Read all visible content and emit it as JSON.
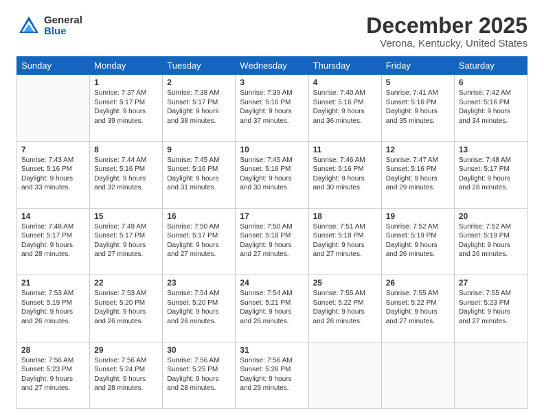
{
  "logo": {
    "general": "General",
    "blue": "Blue"
  },
  "title": "December 2025",
  "subtitle": "Verona, Kentucky, United States",
  "headers": [
    "Sunday",
    "Monday",
    "Tuesday",
    "Wednesday",
    "Thursday",
    "Friday",
    "Saturday"
  ],
  "weeks": [
    [
      {
        "num": "",
        "info": ""
      },
      {
        "num": "1",
        "info": "Sunrise: 7:37 AM\nSunset: 5:17 PM\nDaylight: 9 hours\nand 39 minutes."
      },
      {
        "num": "2",
        "info": "Sunrise: 7:38 AM\nSunset: 5:17 PM\nDaylight: 9 hours\nand 38 minutes."
      },
      {
        "num": "3",
        "info": "Sunrise: 7:39 AM\nSunset: 5:16 PM\nDaylight: 9 hours\nand 37 minutes."
      },
      {
        "num": "4",
        "info": "Sunrise: 7:40 AM\nSunset: 5:16 PM\nDaylight: 9 hours\nand 36 minutes."
      },
      {
        "num": "5",
        "info": "Sunrise: 7:41 AM\nSunset: 5:16 PM\nDaylight: 9 hours\nand 35 minutes."
      },
      {
        "num": "6",
        "info": "Sunrise: 7:42 AM\nSunset: 5:16 PM\nDaylight: 9 hours\nand 34 minutes."
      }
    ],
    [
      {
        "num": "7",
        "info": "Sunrise: 7:43 AM\nSunset: 5:16 PM\nDaylight: 9 hours\nand 33 minutes."
      },
      {
        "num": "8",
        "info": "Sunrise: 7:44 AM\nSunset: 5:16 PM\nDaylight: 9 hours\nand 32 minutes."
      },
      {
        "num": "9",
        "info": "Sunrise: 7:45 AM\nSunset: 5:16 PM\nDaylight: 9 hours\nand 31 minutes."
      },
      {
        "num": "10",
        "info": "Sunrise: 7:45 AM\nSunset: 5:16 PM\nDaylight: 9 hours\nand 30 minutes."
      },
      {
        "num": "11",
        "info": "Sunrise: 7:46 AM\nSunset: 5:16 PM\nDaylight: 9 hours\nand 30 minutes."
      },
      {
        "num": "12",
        "info": "Sunrise: 7:47 AM\nSunset: 5:16 PM\nDaylight: 9 hours\nand 29 minutes."
      },
      {
        "num": "13",
        "info": "Sunrise: 7:48 AM\nSunset: 5:17 PM\nDaylight: 9 hours\nand 28 minutes."
      }
    ],
    [
      {
        "num": "14",
        "info": "Sunrise: 7:48 AM\nSunset: 5:17 PM\nDaylight: 9 hours\nand 28 minutes."
      },
      {
        "num": "15",
        "info": "Sunrise: 7:49 AM\nSunset: 5:17 PM\nDaylight: 9 hours\nand 27 minutes."
      },
      {
        "num": "16",
        "info": "Sunrise: 7:50 AM\nSunset: 5:17 PM\nDaylight: 9 hours\nand 27 minutes."
      },
      {
        "num": "17",
        "info": "Sunrise: 7:50 AM\nSunset: 5:18 PM\nDaylight: 9 hours\nand 27 minutes."
      },
      {
        "num": "18",
        "info": "Sunrise: 7:51 AM\nSunset: 5:18 PM\nDaylight: 9 hours\nand 27 minutes."
      },
      {
        "num": "19",
        "info": "Sunrise: 7:52 AM\nSunset: 5:19 PM\nDaylight: 9 hours\nand 26 minutes."
      },
      {
        "num": "20",
        "info": "Sunrise: 7:52 AM\nSunset: 5:19 PM\nDaylight: 9 hours\nand 26 minutes."
      }
    ],
    [
      {
        "num": "21",
        "info": "Sunrise: 7:53 AM\nSunset: 5:19 PM\nDaylight: 9 hours\nand 26 minutes."
      },
      {
        "num": "22",
        "info": "Sunrise: 7:53 AM\nSunset: 5:20 PM\nDaylight: 9 hours\nand 26 minutes."
      },
      {
        "num": "23",
        "info": "Sunrise: 7:54 AM\nSunset: 5:20 PM\nDaylight: 9 hours\nand 26 minutes."
      },
      {
        "num": "24",
        "info": "Sunrise: 7:54 AM\nSunset: 5:21 PM\nDaylight: 9 hours\nand 26 minutes."
      },
      {
        "num": "25",
        "info": "Sunrise: 7:55 AM\nSunset: 5:22 PM\nDaylight: 9 hours\nand 26 minutes."
      },
      {
        "num": "26",
        "info": "Sunrise: 7:55 AM\nSunset: 5:22 PM\nDaylight: 9 hours\nand 27 minutes."
      },
      {
        "num": "27",
        "info": "Sunrise: 7:55 AM\nSunset: 5:23 PM\nDaylight: 9 hours\nand 27 minutes."
      }
    ],
    [
      {
        "num": "28",
        "info": "Sunrise: 7:56 AM\nSunset: 5:23 PM\nDaylight: 9 hours\nand 27 minutes."
      },
      {
        "num": "29",
        "info": "Sunrise: 7:56 AM\nSunset: 5:24 PM\nDaylight: 9 hours\nand 28 minutes."
      },
      {
        "num": "30",
        "info": "Sunrise: 7:56 AM\nSunset: 5:25 PM\nDaylight: 9 hours\nand 28 minutes."
      },
      {
        "num": "31",
        "info": "Sunrise: 7:56 AM\nSunset: 5:26 PM\nDaylight: 9 hours\nand 29 minutes."
      },
      {
        "num": "",
        "info": ""
      },
      {
        "num": "",
        "info": ""
      },
      {
        "num": "",
        "info": ""
      }
    ]
  ]
}
